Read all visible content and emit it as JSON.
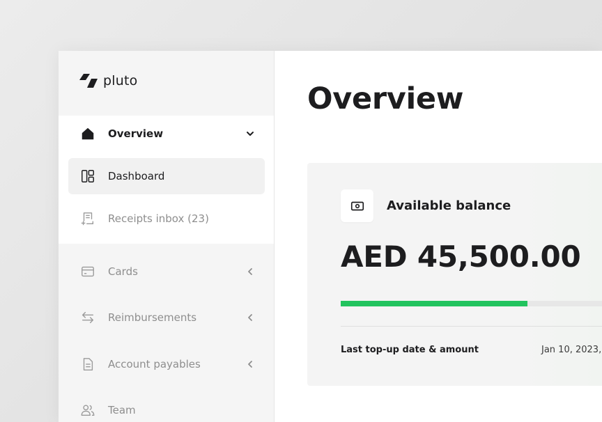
{
  "app": {
    "brand": "pluto"
  },
  "sidebar": {
    "items": [
      {
        "label": "Overview",
        "icon": "home-icon"
      },
      {
        "label": "Dashboard",
        "icon": "dashboard-icon"
      },
      {
        "label": "Receipts inbox (23)",
        "icon": "receipt-icon"
      },
      {
        "label": "Cards",
        "icon": "card-icon"
      },
      {
        "label": "Reimbursements",
        "icon": "transfer-arrows-icon"
      },
      {
        "label": "Account payables",
        "icon": "document-icon"
      },
      {
        "label": "Team",
        "icon": "team-icon"
      }
    ]
  },
  "main": {
    "title": "Overview",
    "balance": {
      "title": "Available balance",
      "amount": "AED 45,500.00",
      "progress_percent": 65,
      "topup_label": "Last top-up date & amount",
      "topup_value": "Jan 10, 2023,"
    }
  },
  "colors": {
    "accent": "#22c35e",
    "sidebar_bg": "#f5f5f5",
    "text_dark": "#1d1d1f",
    "text_muted": "#8e8e8e"
  }
}
